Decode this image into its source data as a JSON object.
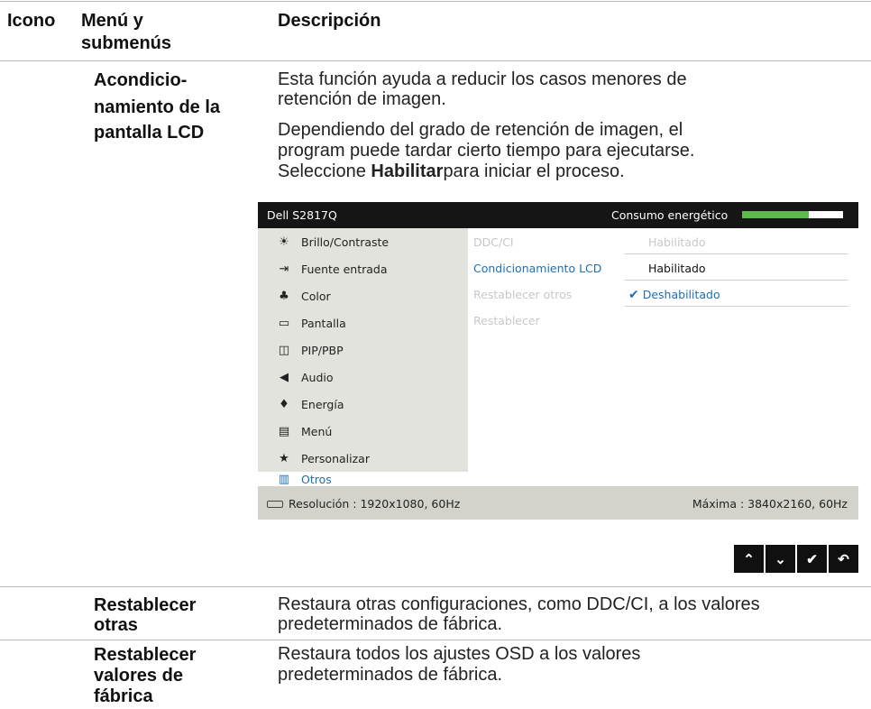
{
  "headers": {
    "icon": "Icono",
    "menu_line1": "Menú y",
    "menu_line2": "submenús",
    "description": "Descripción"
  },
  "section_lcd": {
    "menu_lines": [
      "Acondicio-",
      "namiento de la",
      "pantalla LCD"
    ],
    "desc1_lines": [
      "Esta función ayuda a reducir los casos menores de",
      "retención de imagen."
    ],
    "desc2_lines": [
      "Dependiendo del grado de retención de imagen, el",
      "program puede tardar cierto tiempo para ejecutarse."
    ],
    "desc3_pre": "Seleccione ",
    "desc3_bold": "Habilitar",
    "desc3_post": "para iniciar el proceso."
  },
  "osd": {
    "title": "Dell S2817Q",
    "power_label": "Consumo energético",
    "power_level": 0.66,
    "colors": {
      "header_bg": "#151515",
      "menu_bg": "#e3e3dd",
      "accent": "#1d6fb8",
      "power_fill": "#5db84d"
    },
    "menu_items": [
      {
        "label": "Brillo/Contraste",
        "icon": "brightness-icon"
      },
      {
        "label": "Fuente entrada",
        "icon": "input-source-icon"
      },
      {
        "label": "Color",
        "icon": "color-icon"
      },
      {
        "label": "Pantalla",
        "icon": "display-icon"
      },
      {
        "label": "PIP/PBP",
        "icon": "pip-icon"
      },
      {
        "label": "Audio",
        "icon": "audio-icon"
      },
      {
        "label": "Energía",
        "icon": "energy-icon"
      },
      {
        "label": "Menú",
        "icon": "menu-icon"
      },
      {
        "label": "Personalizar",
        "icon": "star-icon"
      },
      {
        "label": "Otros",
        "icon": "others-icon",
        "active": true
      }
    ],
    "rows": [
      {
        "label": "DDC/CI",
        "value": "Habilitado"
      },
      {
        "label": "Condicionamiento LCD",
        "value": "Habilitado"
      },
      {
        "label": "Restablecer otros",
        "value": "Deshabilitado"
      },
      {
        "label": "Restablecer",
        "value": ""
      }
    ],
    "footer_left": "Resolución : 1920x1080, 60Hz",
    "footer_right": "Máxima : 3840x2160, 60Hz"
  },
  "nav_buttons": [
    {
      "name": "up",
      "glyph": "⌃"
    },
    {
      "name": "down",
      "glyph": "⌄"
    },
    {
      "name": "ok",
      "glyph": "✔"
    },
    {
      "name": "back",
      "glyph": "↶"
    }
  ],
  "section_reset_others": {
    "menu_lines": [
      "Restablecer",
      "otras"
    ],
    "desc_lines": [
      "Restaura otras configuraciones, como DDC/CI, a los valores",
      "predeterminados de fábrica."
    ]
  },
  "section_factory": {
    "menu_lines": [
      "Restablecer",
      "valores de",
      "fábrica"
    ],
    "desc_lines": [
      "Restaura todos los ajustes OSD a los valores",
      "predeterminados de fábrica."
    ]
  }
}
